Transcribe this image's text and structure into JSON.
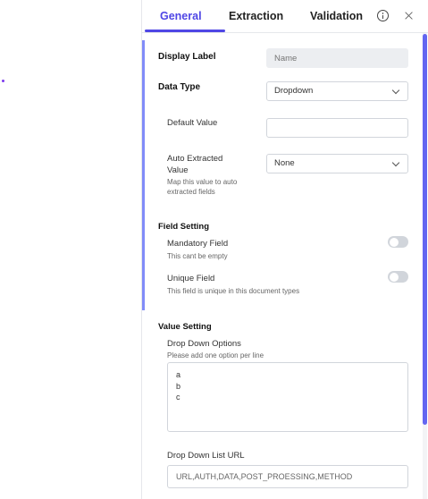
{
  "tabs": [
    {
      "label": "General",
      "active": true
    },
    {
      "label": "Extraction",
      "active": false
    },
    {
      "label": "Validation",
      "active": false
    }
  ],
  "icons": {
    "info": "info-icon",
    "close": "close-icon"
  },
  "colors": {
    "accent": "#4f46e5",
    "scrollbar": "#6366f1",
    "left_accent": "#818cf8"
  },
  "fields": {
    "display_label": {
      "label": "Display Label",
      "placeholder": "Name"
    },
    "data_type": {
      "label": "Data Type",
      "value": "Dropdown"
    },
    "default_value": {
      "label": "Default Value",
      "value": ""
    },
    "auto_extracted": {
      "label_line1": "Auto Extracted",
      "label_line2": "Value",
      "hint_line1": "Map this value to auto",
      "hint_line2": "extracted fields",
      "value": "None"
    }
  },
  "field_setting": {
    "title": "Field Setting",
    "mandatory": {
      "label": "Mandatory Field",
      "hint": "This cant be empty",
      "enabled": false
    },
    "unique": {
      "label": "Unique Field",
      "hint": "This field is unique in this document types",
      "enabled": false
    }
  },
  "value_setting": {
    "title": "Value Setting",
    "options_label": "Drop Down Options",
    "options_hint": "Please add one option per line",
    "options": [
      "a",
      "b",
      "c"
    ],
    "url_label": "Drop Down List URL",
    "url_placeholder": "URL,AUTH,DATA,POST_PROESSING,METHOD"
  }
}
